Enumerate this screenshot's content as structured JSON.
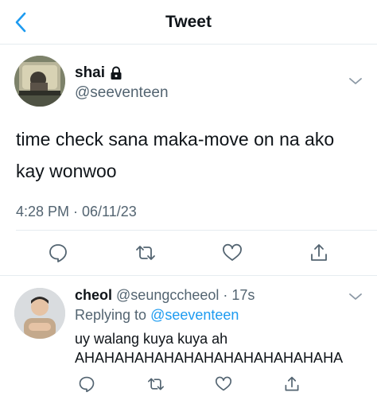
{
  "header": {
    "title": "Tweet",
    "back_icon": "chevron-left-icon",
    "accent": "#1d9bf0"
  },
  "tweet": {
    "display_name": "shai",
    "protected_icon": "lock-icon",
    "handle": "@seeventeen",
    "text": "time check sana maka-move on na ako kay wonwoo",
    "timestamp": "4:28 PM · 06/11/23",
    "more_icon": "chevron-down-icon",
    "actions": [
      "reply-icon",
      "retweet-icon",
      "like-icon",
      "share-icon"
    ]
  },
  "reply": {
    "display_name": "cheol",
    "handle": "@seungccheeol",
    "separator": " · ",
    "time": "17s",
    "replying_prefix": "Replying to ",
    "replying_to": "@seeventeen",
    "text": "uy walang kuya kuya ah\nAHAHAHAHAHAHAHAHAHAHAHAHAHA",
    "more_icon": "chevron-down-icon",
    "actions": [
      "reply-icon",
      "retweet-icon",
      "like-icon",
      "share-icon"
    ]
  },
  "colors": {
    "text": "#0f1419",
    "secondary": "#536471",
    "link": "#1d9bf0",
    "divider": "#e6ecf0"
  }
}
